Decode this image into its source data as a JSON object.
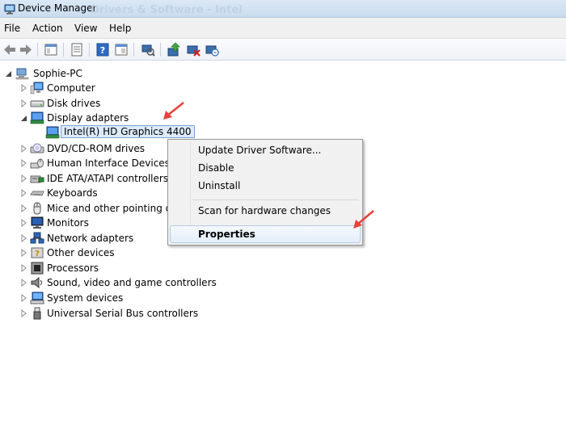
{
  "window": {
    "title": "Device Manager",
    "background_text": "Drivers & Software - Intel"
  },
  "menu": [
    "File",
    "Action",
    "View",
    "Help"
  ],
  "toolbar": {
    "icons": [
      "back-arrow-icon",
      "forward-arrow-icon",
      "console-tree-icon",
      "properties-icon",
      "help-icon",
      "view-icon",
      "scan-hardware-icon",
      "update-driver-icon",
      "disable-device-icon",
      "uninstall-device-icon"
    ]
  },
  "tree": {
    "root": "Sophie-PC",
    "items": [
      {
        "label": "Computer",
        "icon": "computer-icon",
        "state": "collapsed"
      },
      {
        "label": "Disk drives",
        "icon": "disk-drive-icon",
        "state": "collapsed"
      },
      {
        "label": "Display adapters",
        "icon": "display-adapter-icon",
        "state": "expanded"
      },
      {
        "label": "Intel(R) HD Graphics 4400",
        "icon": "display-adapter-icon",
        "state": "leaf",
        "selected": true
      },
      {
        "label": "DVD/CD-ROM drives",
        "icon": "dvd-drive-icon",
        "state": "collapsed"
      },
      {
        "label": "Human Interface Devices",
        "icon": "hid-icon",
        "state": "collapsed"
      },
      {
        "label": "IDE ATA/ATAPI controllers",
        "icon": "ide-controller-icon",
        "state": "collapsed"
      },
      {
        "label": "Keyboards",
        "icon": "keyboard-icon",
        "state": "collapsed"
      },
      {
        "label": "Mice and other pointing de",
        "icon": "mouse-icon",
        "state": "collapsed"
      },
      {
        "label": "Monitors",
        "icon": "monitor-icon",
        "state": "collapsed"
      },
      {
        "label": "Network adapters",
        "icon": "network-adapter-icon",
        "state": "collapsed"
      },
      {
        "label": "Other devices",
        "icon": "other-devices-icon",
        "state": "collapsed"
      },
      {
        "label": "Processors",
        "icon": "processor-icon",
        "state": "collapsed"
      },
      {
        "label": "Sound, video and game controllers",
        "icon": "sound-icon",
        "state": "collapsed"
      },
      {
        "label": "System devices",
        "icon": "system-devices-icon",
        "state": "collapsed"
      },
      {
        "label": "Universal Serial Bus controllers",
        "icon": "usb-icon",
        "state": "collapsed"
      }
    ]
  },
  "context_menu": {
    "items": [
      {
        "label": "Update Driver Software..."
      },
      {
        "label": "Disable"
      },
      {
        "label": "Uninstall"
      },
      {
        "label": "Scan for hardware changes"
      },
      {
        "label": "Properties",
        "bold": true,
        "highlighted": true
      }
    ]
  },
  "colors": {
    "annotation_arrow": "#e8423a",
    "selection_border": "#7da2ce",
    "selection_fill": "#dceaf9"
  }
}
